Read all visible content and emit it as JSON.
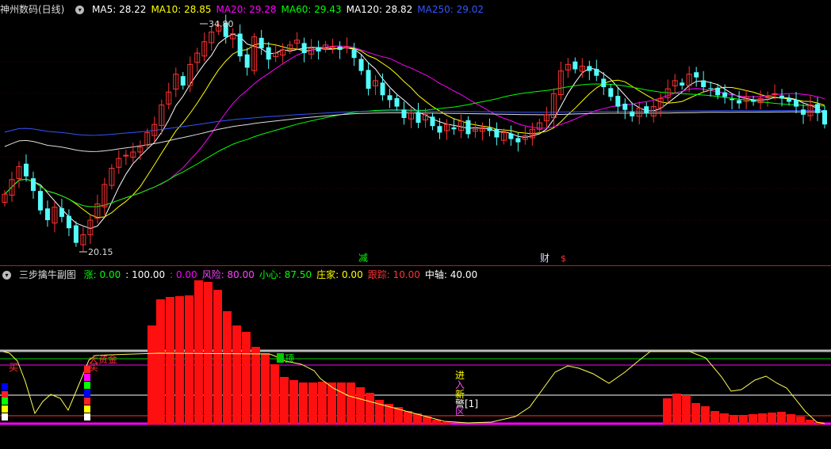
{
  "main_header": {
    "stock_title": "神州数码(日线)",
    "indicators": [
      {
        "text": "MA5: 28.22",
        "color": "#ffffff"
      },
      {
        "text": "MA10: 28.85",
        "color": "#ffff00"
      },
      {
        "text": "MA20: 29.28",
        "color": "#ff00ff"
      },
      {
        "text": "MA60: 29.43",
        "color": "#00ff00"
      },
      {
        "text": "MA120: 28.82",
        "color": "#ffffff"
      },
      {
        "text": "MA250: 29.02",
        "color": "#3355ff"
      }
    ]
  },
  "price_labels": {
    "high": "34.80",
    "low": "20.15"
  },
  "event_markers": {
    "m1": "减",
    "m2": "财",
    "m3": "$"
  },
  "sub_header": {
    "title": "三步擒牛副图",
    "fields": [
      {
        "text": "涨: 0.00",
        "color": "#00ff00"
      },
      {
        "text": ": 100.00",
        "color": "#ffffff"
      },
      {
        "text": ": 0.00",
        "color": "#ff00ff"
      },
      {
        "text": "风险: 80.00",
        "color": "#ff44ff"
      },
      {
        "text": "小心: 87.50",
        "color": "#00ff00"
      },
      {
        "text": "庄家: 0.00",
        "color": "#ffff00"
      },
      {
        "text": "跟踪: 10.00",
        "color": "#ff3333"
      },
      {
        "text": "中轴: 40.00",
        "color": "#ffffff"
      }
    ]
  },
  "sub_labels": {
    "buy1": "买",
    "big_fund": "大资金",
    "buy2": "买",
    "top": "顶",
    "enter": "进",
    "into": "入",
    "new": "新",
    "watch": "警[1]",
    "zone": "区"
  },
  "colors": {
    "up": "#ff3232",
    "down": "#54fcfc",
    "bg": "#000000"
  }
}
